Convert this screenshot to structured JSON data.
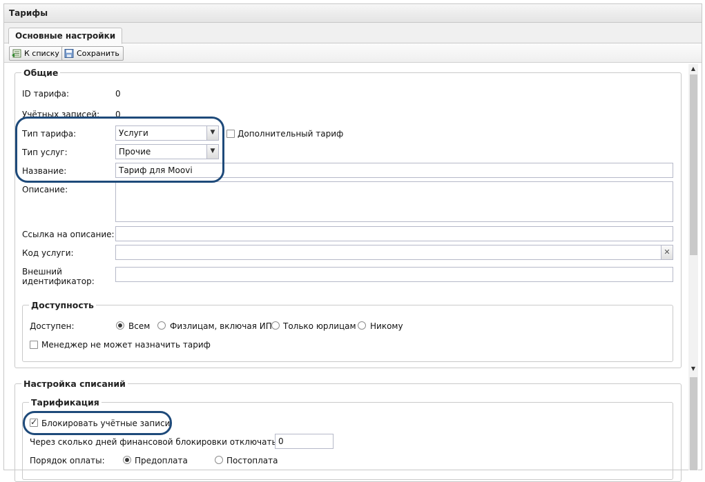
{
  "window": {
    "title": "Тарифы"
  },
  "tabs": [
    {
      "label": "Основные настройки"
    }
  ],
  "toolbar": {
    "back_label": "К списку",
    "save_label": "Сохранить"
  },
  "general": {
    "legend": "Общие",
    "tariff_id_label": "ID тарифа:",
    "tariff_id_value": "0",
    "accounts_label": "Учётных записей:",
    "accounts_value": "0",
    "tariff_type_label": "Тип тарифа:",
    "tariff_type_value": "Услуги",
    "additional_tariff_label": "Дополнительный тариф",
    "additional_tariff_checked": false,
    "service_type_label": "Тип услуг:",
    "service_type_value": "Прочие",
    "name_label": "Название:",
    "name_value": "Тариф для Moovi",
    "description_label": "Описание:",
    "description_value": "",
    "link_label": "Ссылка на описание:",
    "link_value": "",
    "service_code_label": "Код услуги:",
    "service_code_value": "",
    "external_id_label_1": "Внешний",
    "external_id_label_2": "идентификатор:",
    "external_id_value": ""
  },
  "availability": {
    "legend": "Доступность",
    "available_label": "Доступен:",
    "options": [
      "Всем",
      "Физлицам, включая ИП",
      "Только юрлицам",
      "Никому"
    ],
    "selected": "Всем",
    "manager_cannot_assign_label": "Менеджер не может назначить тариф",
    "manager_cannot_assign_checked": false
  },
  "charges": {
    "legend": "Настройка списаний",
    "tarification_legend": "Тарификация",
    "block_accounts_label": "Блокировать учётные записи",
    "block_accounts_checked": true,
    "days_label": "Через сколько дней финансовой блокировки отключать УЗ:",
    "days_value": "0",
    "payment_order_label": "Порядок оплаты:",
    "payment_options": [
      "Предоплата",
      "Постоплата"
    ],
    "payment_selected": "Предоплата"
  },
  "colors": {
    "highlight": "#1e4a7a"
  }
}
